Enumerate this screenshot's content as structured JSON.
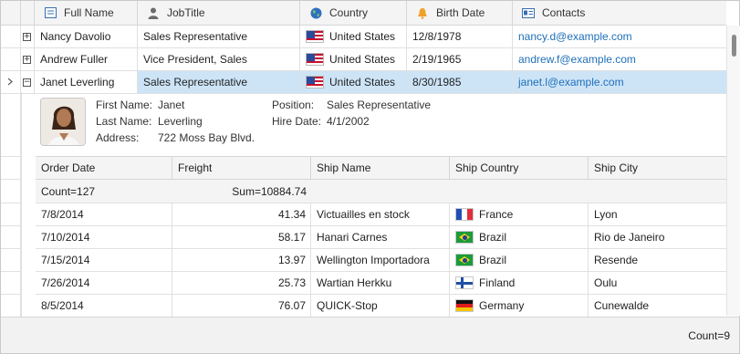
{
  "columns": [
    {
      "label": "Full Name",
      "icon": "name-icon"
    },
    {
      "label": "JobTitle",
      "icon": "person-icon"
    },
    {
      "label": "Country",
      "icon": "globe-icon"
    },
    {
      "label": "Birth Date",
      "icon": "bell-icon"
    },
    {
      "label": "Contacts",
      "icon": "contact-card-icon"
    }
  ],
  "rows": [
    {
      "name": "Nancy Davolio",
      "job": "Sales Representative",
      "country": "United States",
      "birth": "12/8/1978",
      "contact": "nancy.d@example.com",
      "expander": "+"
    },
    {
      "name": "Andrew Fuller",
      "job": "Vice President, Sales",
      "country": "United States",
      "birth": "2/19/1965",
      "contact": "andrew.f@example.com",
      "expander": "+"
    },
    {
      "name": "Janet Leverling",
      "job": "Sales Representative",
      "country": "United States",
      "birth": "8/30/1985",
      "contact": "janet.l@example.com",
      "expander": "−",
      "selected": true
    }
  ],
  "detail": {
    "first_name_label": "First Name:",
    "first_name": "Janet",
    "last_name_label": "Last Name:",
    "last_name": "Leverling",
    "address_label": "Address:",
    "address": "722 Moss Bay Blvd.",
    "position_label": "Position:",
    "position": "Sales Representative",
    "hire_label": "Hire Date:",
    "hire": "4/1/2002"
  },
  "orders": {
    "columns": [
      "Order Date",
      "Freight",
      "Ship Name",
      "Ship Country",
      "Ship City"
    ],
    "summary_count": "Count=127",
    "summary_sum": "Sum=10884.74",
    "rows": [
      {
        "date": "7/8/2014",
        "freight": "41.34",
        "ship": "Victuailles en stock",
        "country": "France",
        "flag": "f-france",
        "city": "Lyon"
      },
      {
        "date": "7/10/2014",
        "freight": "58.17",
        "ship": "Hanari Carnes",
        "country": "Brazil",
        "flag": "f-brazil",
        "city": "Rio de Janeiro"
      },
      {
        "date": "7/15/2014",
        "freight": "13.97",
        "ship": "Wellington Importadora",
        "country": "Brazil",
        "flag": "f-brazil",
        "city": "Resende"
      },
      {
        "date": "7/26/2014",
        "freight": "25.73",
        "ship": "Wartian Herkku",
        "country": "Finland",
        "flag": "f-finland",
        "city": "Oulu"
      },
      {
        "date": "8/5/2014",
        "freight": "76.07",
        "ship": "QUICK-Stop",
        "country": "Germany",
        "flag": "f-germany",
        "city": "Cunewalde"
      }
    ]
  },
  "footer": {
    "count": "Count=9"
  }
}
